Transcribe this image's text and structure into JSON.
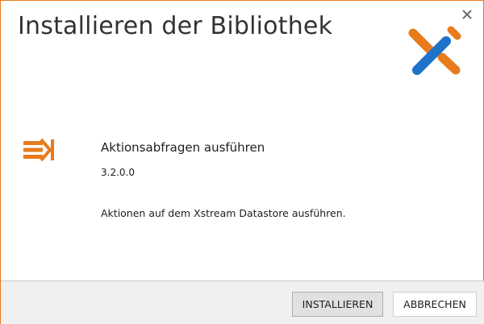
{
  "dialog": {
    "title": "Installieren der Bibliothek",
    "close_icon": "close-icon",
    "logo_icon": "xstream-x-logo",
    "accent_color": "#e87b1c",
    "logo_blue": "#1e73c8"
  },
  "library": {
    "icon": "action-query-icon",
    "name": "Aktionsabfragen ausführen",
    "version": "3.2.0.0",
    "description": "Aktionen auf dem Xstream Datastore ausführen."
  },
  "footer": {
    "install_label": "INSTALLIEREN",
    "cancel_label": "ABBRECHEN"
  }
}
